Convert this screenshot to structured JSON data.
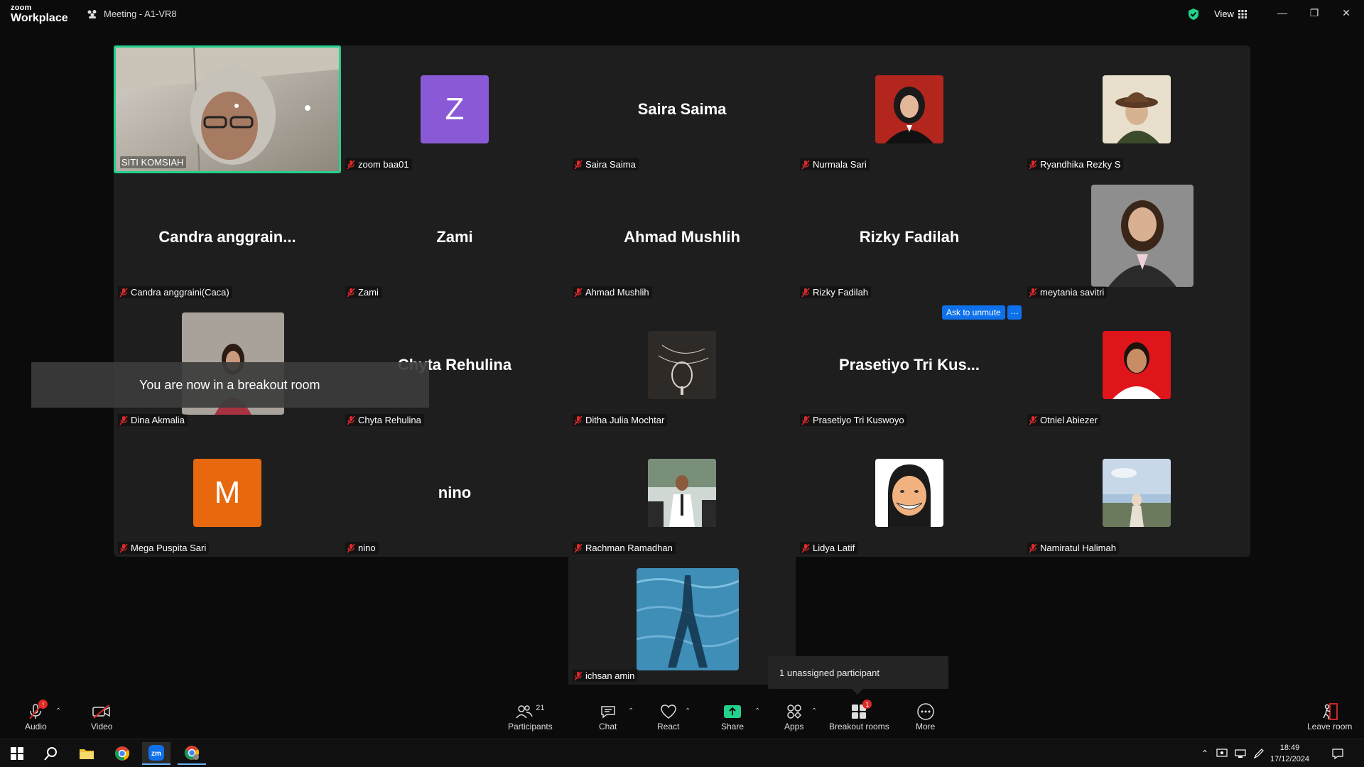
{
  "titlebar": {
    "logo_line1": "zoom",
    "logo_line2": "Workplace",
    "meeting_title": "Meeting - A1-VR8",
    "view_label": "View"
  },
  "tiles": [
    {
      "name": "SITI KOMSIAH",
      "type": "video"
    },
    {
      "name": "zoom baa01",
      "type": "letter",
      "letter": "Z",
      "color": "#8a5ad6"
    },
    {
      "name": "Saira Saima",
      "type": "text",
      "display": "Saira Saima"
    },
    {
      "name": "Nurmala Sari",
      "type": "photo"
    },
    {
      "name": "Ryandhika Rezky S",
      "type": "photo"
    },
    {
      "name": "Candra anggraini(Caca)",
      "type": "text",
      "display": "Candra  anggrain..."
    },
    {
      "name": "Zami",
      "type": "text",
      "display": "Zami"
    },
    {
      "name": "Ahmad Mushlih",
      "type": "text",
      "display": "Ahmad Mushlih"
    },
    {
      "name": "Rizky Fadilah",
      "type": "text",
      "display": "Rizky Fadilah"
    },
    {
      "name": "meytania savitri",
      "type": "photo"
    },
    {
      "name": "Dina Akmalia",
      "type": "photo"
    },
    {
      "name": "Chyta Rehulina",
      "type": "text",
      "display": "Chyta Rehulina"
    },
    {
      "name": "Ditha Julia Mochtar",
      "type": "photo"
    },
    {
      "name": "Prasetiyo Tri Kuswoyo",
      "type": "text",
      "display": "Prasetiyo Tri Kus..."
    },
    {
      "name": "Otniel Abiezer",
      "type": "photo"
    },
    {
      "name": "Mega Puspita Sari",
      "type": "letter",
      "letter": "M",
      "color": "#e8680e"
    },
    {
      "name": "nino",
      "type": "text",
      "display": "nino"
    },
    {
      "name": "Rachman Ramadhan",
      "type": "photo"
    },
    {
      "name": "Lidya Latif",
      "type": "photo"
    },
    {
      "name": "Namiratul Halimah",
      "type": "photo"
    },
    {
      "name": "ichsan amin",
      "type": "photo"
    }
  ],
  "toast": "You are now in a breakout room",
  "ask_unmute": "Ask to unmute",
  "ask_more": "…",
  "unassigned": "1 unassigned participant",
  "toolbar": {
    "audio": "Audio",
    "video": "Video",
    "participants": "Participants",
    "participants_count": "21",
    "chat": "Chat",
    "react": "React",
    "share": "Share",
    "apps": "Apps",
    "breakout": "Breakout rooms",
    "breakout_badge": "1",
    "more": "More",
    "leave": "Leave room"
  },
  "taskbar": {
    "time": "18:49",
    "date": "17/12/2024"
  },
  "colors": {
    "active_border": "#23d18b",
    "muted_red": "#e02828",
    "accent_blue": "#0e71eb",
    "share_green": "#23d18b"
  }
}
